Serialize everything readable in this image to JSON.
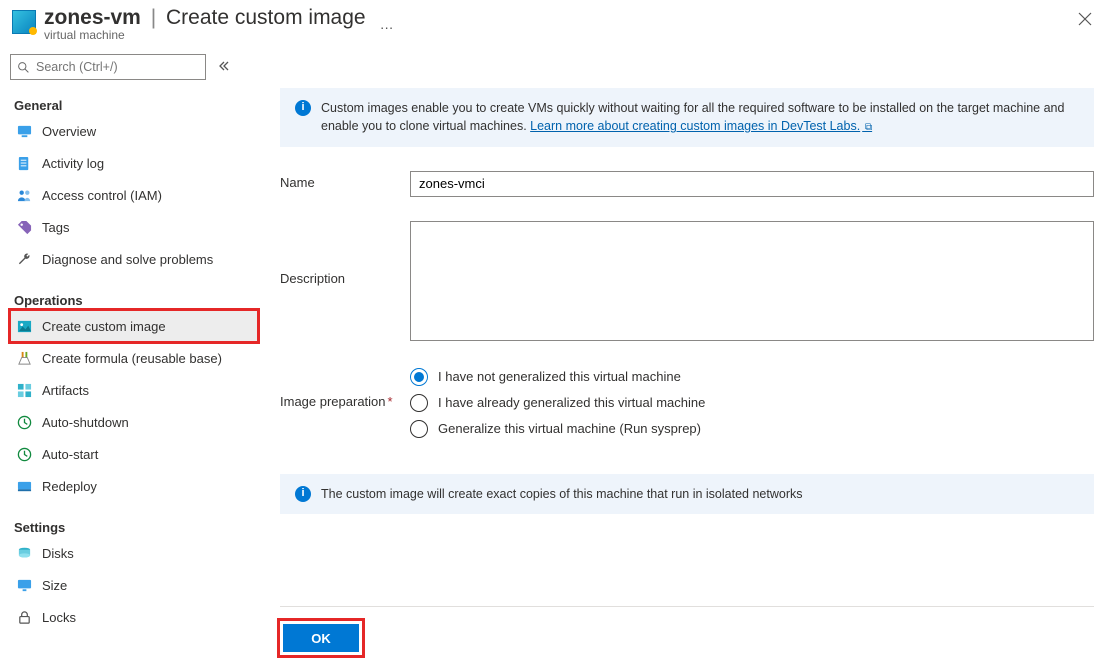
{
  "header": {
    "resource_name": "zones-vm",
    "blade_title": "Create custom image",
    "subtitle": "virtual machine",
    "more": "…"
  },
  "search": {
    "placeholder": "Search (Ctrl+/)"
  },
  "sidebar": {
    "sections": [
      {
        "title": "General",
        "items": [
          {
            "label": "Overview",
            "icon": "monitor-icon",
            "iconClass": "ic-blue"
          },
          {
            "label": "Activity log",
            "icon": "log-icon",
            "iconClass": "ic-blue"
          },
          {
            "label": "Access control (IAM)",
            "icon": "people-icon",
            "iconClass": "ic-blue"
          },
          {
            "label": "Tags",
            "icon": "tag-icon",
            "iconClass": "ic-purple"
          },
          {
            "label": "Diagnose and solve problems",
            "icon": "wrench-icon",
            "iconClass": "ic-gray"
          }
        ]
      },
      {
        "title": "Operations",
        "items": [
          {
            "label": "Create custom image",
            "icon": "image-icon",
            "iconClass": "ic-teal",
            "selected": true,
            "highlight": true
          },
          {
            "label": "Create formula (reusable base)",
            "icon": "flask-icon",
            "iconClass": "ic-orange"
          },
          {
            "label": "Artifacts",
            "icon": "artifacts-icon",
            "iconClass": "ic-teal"
          },
          {
            "label": "Auto-shutdown",
            "icon": "clock-icon",
            "iconClass": "ic-green"
          },
          {
            "label": "Auto-start",
            "icon": "clock-icon",
            "iconClass": "ic-green"
          },
          {
            "label": "Redeploy",
            "icon": "redeploy-icon",
            "iconClass": "ic-blue"
          }
        ]
      },
      {
        "title": "Settings",
        "items": [
          {
            "label": "Disks",
            "icon": "disks-icon",
            "iconClass": "ic-teal"
          },
          {
            "label": "Size",
            "icon": "size-icon",
            "iconClass": "ic-blue"
          },
          {
            "label": "Locks",
            "icon": "lock-icon",
            "iconClass": "ic-gray"
          }
        ]
      }
    ]
  },
  "main": {
    "info1_text": "Custom images enable you to create VMs quickly without waiting for all the required software to be installed on the target machine and enable you to clone virtual machines. ",
    "info1_link": "Learn more about creating custom images in DevTest Labs.",
    "name_label": "Name",
    "name_value": "zones-vmci",
    "desc_label": "Description",
    "desc_value": "",
    "prep_label": "Image preparation",
    "prep_options": [
      "I have not generalized this virtual machine",
      "I have already generalized this virtual machine",
      "Generalize this virtual machine (Run sysprep)"
    ],
    "prep_selected_index": 0,
    "info2_text": "The custom image will create exact copies of this machine that run in isolated networks",
    "ok_label": "OK"
  }
}
